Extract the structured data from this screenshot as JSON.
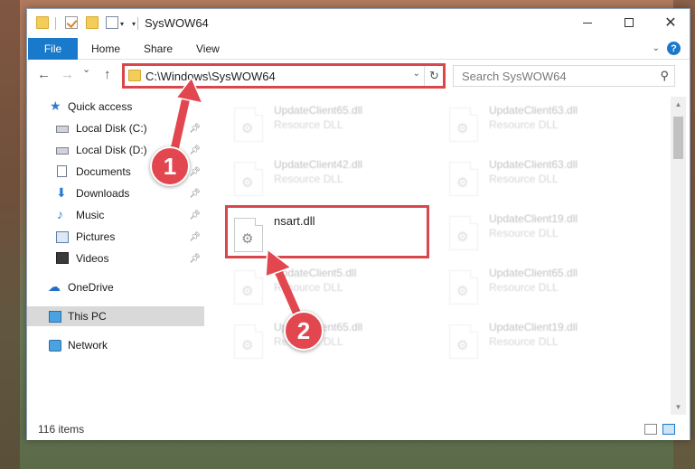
{
  "window": {
    "title": "SysWOW64",
    "minimize_label": "Minimize",
    "maximize_label": "Maximize",
    "close_label": "Close"
  },
  "ribbon": {
    "tabs": [
      "File",
      "Home",
      "Share",
      "View"
    ],
    "help": "?"
  },
  "nav": {
    "back": "←",
    "forward": "→",
    "recent": "⌄",
    "up": "↑",
    "address": "C:\\Windows\\SysWOW64",
    "refresh": "↻",
    "dropdown": "⌄"
  },
  "search": {
    "placeholder": "Search SysWOW64"
  },
  "sidebar": {
    "items": [
      {
        "label": "Quick access",
        "icon": "star-icon",
        "pinned": false
      },
      {
        "label": "Local Disk (C:)",
        "icon": "drive-icon",
        "pinned": true
      },
      {
        "label": "Local Disk (D:)",
        "icon": "drive-icon",
        "pinned": true
      },
      {
        "label": "Documents",
        "icon": "documents-icon",
        "pinned": true
      },
      {
        "label": "Downloads",
        "icon": "download-icon",
        "pinned": true
      },
      {
        "label": "Music",
        "icon": "music-icon",
        "pinned": true
      },
      {
        "label": "Pictures",
        "icon": "pictures-icon",
        "pinned": true
      },
      {
        "label": "Videos",
        "icon": "videos-icon",
        "pinned": true
      },
      {
        "label": "OneDrive",
        "icon": "onedrive-icon",
        "pinned": false
      },
      {
        "label": "This PC",
        "icon": "computer-icon",
        "pinned": false,
        "selected": true
      },
      {
        "label": "Network",
        "icon": "network-icon",
        "pinned": false
      }
    ]
  },
  "files": [
    {
      "name": "UpdateClient65.dll",
      "type": "Resource DLL",
      "faded": true
    },
    {
      "name": "UpdateClient63.dll",
      "type": "Resource DLL",
      "faded": true
    },
    {
      "name": "UpdateClient42.dll",
      "type": "Resource DLL",
      "faded": true
    },
    {
      "name": "UpdateClient63.dll",
      "type": "Resource DLL",
      "faded": true
    },
    {
      "name": "nsart.dll",
      "type": "",
      "faded": false
    },
    {
      "name": "UpdateClient19.dll",
      "type": "Resource DLL",
      "faded": true
    },
    {
      "name": "UpdateClient5.dll",
      "type": "Resource DLL",
      "faded": true
    },
    {
      "name": "UpdateClient65.dll",
      "type": "Resource DLL",
      "faded": true
    },
    {
      "name": "UpdateClient65.dll",
      "type": "Resource DLL",
      "faded": true
    },
    {
      "name": "UpdateClient19.dll",
      "type": "Resource DLL",
      "faded": true
    }
  ],
  "status": {
    "item_count": "116 items"
  },
  "callouts": {
    "one": "1",
    "two": "2"
  },
  "colors": {
    "accent": "#1979ca",
    "highlight": "#d9474d",
    "callout": "#e2474f"
  }
}
